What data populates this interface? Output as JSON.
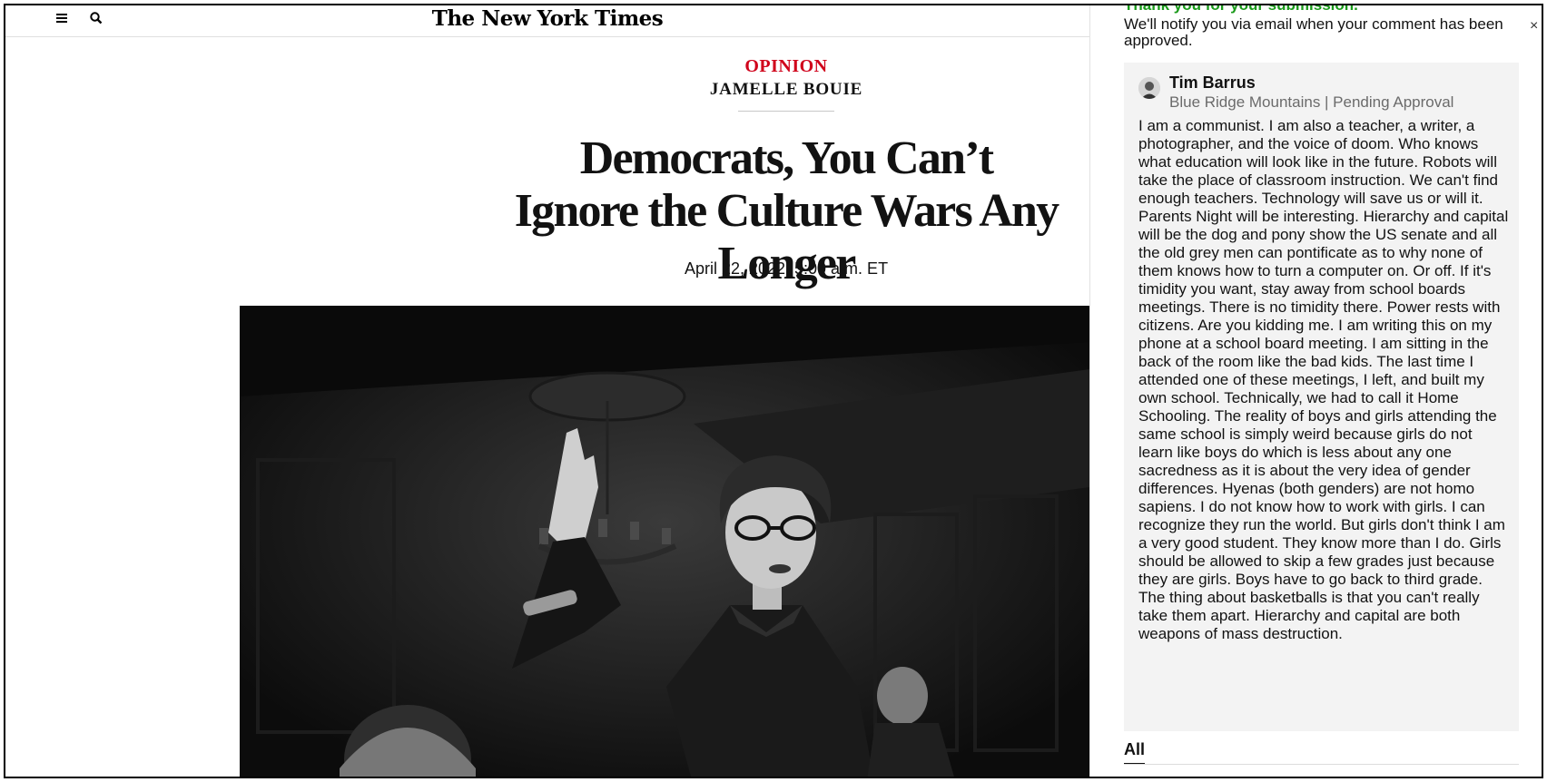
{
  "header": {
    "masthead": "The New York Times",
    "menu_icon": "hamburger-menu-icon",
    "search_icon": "search-icon"
  },
  "article": {
    "kicker": "OPINION",
    "byline": "JAMELLE BOUIE",
    "headline": "Democrats, You Can’t Ignore the Culture Wars Any Longer",
    "dateline": "April 22, 2022, 5:00 a.m. ET",
    "kicker_color": "#d0021b"
  },
  "comments_panel": {
    "submission_title": "Thank you for your submission.",
    "submission_message": "We'll notify you via email when your comment has been approved.",
    "close_icon": "close-icon",
    "comment": {
      "author": "Tim Barrus",
      "meta": "Blue Ridge Mountains | Pending Approval",
      "body": "I am a communist. I am also a teacher, a writer, a photographer, and the voice of doom. Who knows what education will look like in the future. Robots will take the place of classroom instruction. We can't find enough teachers. Technology will save us or will it. Parents Night will be interesting. Hierarchy and capital will be the dog and pony show the US senate and all the old grey men can pontificate as to why none of them knows how to turn a computer on. Or off. If it's timidity you want, stay away from school boards meetings. There is no timidity there. Power rests with citizens. Are you kidding me. I am writing this on my phone at a school board meeting. I am sitting in the back of the room like the bad kids. The last time I attended one of these meetings, I left, and built my own school. Technically, we had to call it Home Schooling. The reality of boys and girls attending the same school is simply weird because girls do not learn like boys do which is less about any one sacredness as it is about the very idea of gender differences. Hyenas (both genders) are not homo sapiens. I do not know how to work with girls. I can recognize they run the world. But girls don't think I am a very good student. They know more than I do. Girls should be allowed to skip a few grades just because they are girls. Boys have to go back to third grade. The thing about basketballs is that you can't really take them apart. Hierarchy and capital are both weapons of mass destruction."
    },
    "tab_all": "All",
    "success_color": "#1a9a1a"
  }
}
